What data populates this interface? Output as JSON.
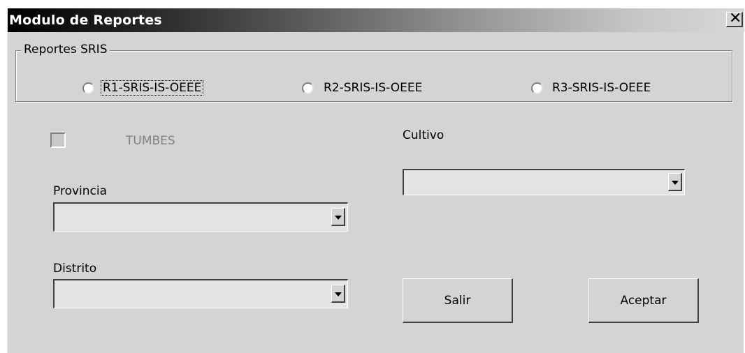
{
  "window": {
    "title": "Modulo de Reportes",
    "close_symbol": "✕"
  },
  "report_frame": {
    "legend": "Reportes SRIS",
    "options": [
      {
        "label": "R1-SRIS-IS-OEEE",
        "selected": false,
        "focused": true
      },
      {
        "label": "R2-SRIS-IS-OEEE",
        "selected": false,
        "focused": false
      },
      {
        "label": "R3-SRIS-IS-OEEE",
        "selected": false,
        "focused": false
      }
    ]
  },
  "region_checkbox": {
    "label": "TUMBES",
    "checked": false,
    "enabled": false
  },
  "provincia": {
    "label": "Provincia",
    "value": ""
  },
  "distrito": {
    "label": "Distrito",
    "value": ""
  },
  "cultivo": {
    "label": "Cultivo",
    "value": ""
  },
  "buttons": {
    "salir": "Salir",
    "aceptar": "Aceptar"
  },
  "icons": {
    "close": "close-icon",
    "dropdown": "chevron-down-icon",
    "radio": "radio-icon",
    "checkbox": "checkbox-icon"
  }
}
